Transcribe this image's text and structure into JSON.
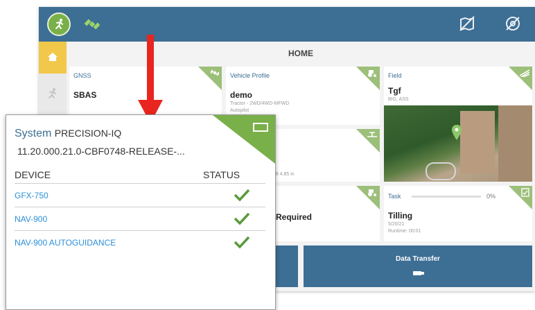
{
  "home": {
    "title": "HOME"
  },
  "cards": {
    "gnss": {
      "label": "GNSS",
      "value": "SBAS"
    },
    "vehicle": {
      "label": "Vehicle Profile",
      "value": "demo",
      "line1": "Tractor - 2WD/4WD-MFWD",
      "line2": "Autopilot"
    },
    "field": {
      "label": "Field",
      "value": "Tgf",
      "sub": "BIG, ASS"
    },
    "implement": {
      "width": "0 ft 4.85 in"
    },
    "calibration": {
      "value": "Required"
    },
    "task": {
      "label": "Task",
      "progress_text": "0%",
      "progress": 0,
      "value": "Tilling",
      "date": "5/20/21",
      "runtime": "Runtime: 00:01"
    }
  },
  "buttons": {
    "data_transfer": "Data Transfer"
  },
  "system_panel": {
    "system_label": "System",
    "product": "PRECISION-IQ",
    "version": "11.20.000.21.0-CBF0748-RELEASE-...",
    "device_header": "DEVICE",
    "status_header": "STATUS",
    "devices": [
      {
        "name": "GFX-750"
      },
      {
        "name": "NAV-900"
      },
      {
        "name": "NAV-900 AUTOGUIDANCE"
      }
    ]
  },
  "colors": {
    "header": "#3d6e94",
    "accent_green": "#79b04a",
    "home_tab": "#f2c84b",
    "arrow": "#e8261f",
    "link": "#2b8fd8"
  },
  "icons": {
    "logo": "runner-icon",
    "satellite": "satellite-icon",
    "map_off": "map-off-icon",
    "no_steer": "steering-off-icon",
    "home": "home-icon"
  }
}
